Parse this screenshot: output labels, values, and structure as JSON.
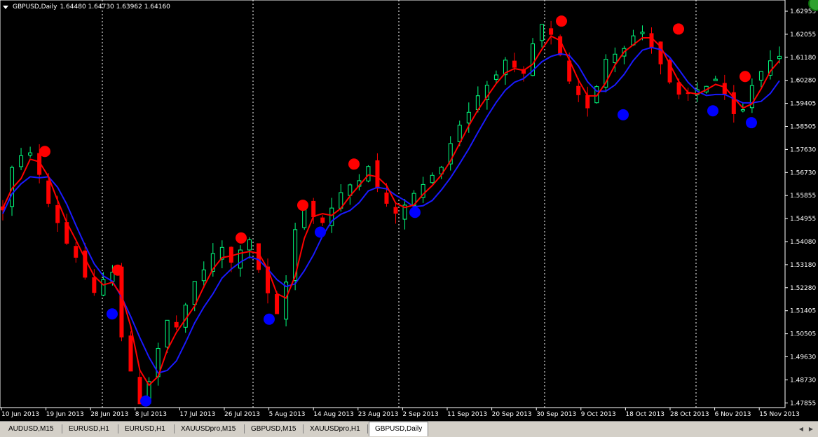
{
  "title": {
    "symbol": "GBPUSD,Daily",
    "ohlc": "1.64480 1.64730 1.63962 1.64160"
  },
  "axis": {
    "price_labels": [
      "1.62955",
      "1.62055",
      "1.61180",
      "1.60280",
      "1.59405",
      "1.58505",
      "1.57630",
      "1.56730",
      "1.55855",
      "1.54955",
      "1.54080",
      "1.53180",
      "1.52280",
      "1.51405",
      "1.50505",
      "1.49630",
      "1.48730",
      "1.47855"
    ],
    "date_labels": [
      "10 Jun 2013",
      "19 Jun 2013",
      "28 Jun 2013",
      "8 Jul 2013",
      "17 Jul 2013",
      "26 Jul 2013",
      "5 Aug 2013",
      "14 Aug 2013",
      "23 Aug 2013",
      "2 Sep 2013",
      "11 Sep 2013",
      "20 Sep 2013",
      "30 Sep 2013",
      "9 Oct 2013",
      "18 Oct 2013",
      "28 Oct 2013",
      "6 Nov 2013",
      "15 Nov 2013"
    ]
  },
  "tabs": [
    {
      "label": "AUDUSD,M15",
      "active": false
    },
    {
      "label": "EURUSD,H1",
      "active": false
    },
    {
      "label": "EURUSD,H1",
      "active": false
    },
    {
      "label": "XAUUSDpro,M15",
      "active": false
    },
    {
      "label": "GBPUSD,M15",
      "active": false
    },
    {
      "label": "XAUUSDpro,H1",
      "active": false
    },
    {
      "label": "GBPUSD,Daily",
      "active": true
    }
  ],
  "colors": {
    "background": "#000000",
    "bull": "#00ff7f",
    "bear": "#ff0000",
    "red_line": "#ff0000",
    "blue_line": "#1a1aff",
    "grid": "#ffffff",
    "axis_text": "#ffffff"
  },
  "chart_data": {
    "type": "candlestick",
    "x_start": "10 Jun 2013",
    "x_end": "19 Nov 2013",
    "ylim": [
      1.4775,
      1.632
    ],
    "trend_close_approx": [
      1.553,
      1.568,
      1.572,
      1.575,
      1.565,
      1.555,
      1.548,
      1.54,
      1.535,
      1.527,
      1.52,
      1.525,
      1.53,
      1.505,
      1.49,
      1.48,
      1.488,
      1.5,
      1.51,
      1.508,
      1.515,
      1.525,
      1.53,
      1.535,
      1.538,
      1.532,
      1.538,
      1.54,
      1.53,
      1.52,
      1.512,
      1.525,
      1.545,
      1.555,
      1.55,
      1.548,
      1.553,
      1.558,
      1.562,
      1.565,
      1.57,
      1.56,
      1.555,
      1.55,
      1.555,
      1.558,
      1.562,
      1.565,
      1.57,
      1.578,
      1.585,
      1.59,
      1.596,
      1.6,
      1.605,
      1.608,
      1.605,
      1.603,
      1.615,
      1.622,
      1.618,
      1.61,
      1.6,
      1.595,
      1.592,
      1.6,
      1.61,
      1.612,
      1.615,
      1.618,
      1.62,
      1.615,
      1.608,
      1.6,
      1.595,
      1.596,
      1.598,
      1.6,
      1.602,
      1.595,
      1.588,
      1.59,
      1.6,
      1.605,
      1.61,
      1.612
    ],
    "markers_red": [
      {
        "date": "19 Jun 2013",
        "price": 1.5746
      },
      {
        "date": "1 Jul 2013",
        "price": 1.5296
      },
      {
        "date": "26 Jul 2013",
        "price": 1.5418
      },
      {
        "date": "6 Aug 2013",
        "price": 1.5542
      },
      {
        "date": "19 Aug 2013",
        "price": 1.5698
      },
      {
        "date": "30 Sep 2013",
        "price": 1.624
      },
      {
        "date": "25 Oct 2013",
        "price": 1.621
      },
      {
        "date": "8 Nov 2013",
        "price": 1.603
      }
    ],
    "markers_blue": [
      {
        "date": "28 Jun 2013",
        "price": 1.513
      },
      {
        "date": "8 Jul 2013",
        "price": 1.48
      },
      {
        "date": "2 Aug 2013",
        "price": 1.511
      },
      {
        "date": "15 Aug 2013",
        "price": 1.544
      },
      {
        "date": "30 Aug 2013",
        "price": 1.5515
      },
      {
        "date": "10 Oct 2013",
        "price": 1.5885
      },
      {
        "date": "5 Nov 2013",
        "price": 1.59
      },
      {
        "date": "12 Nov 2013",
        "price": 1.5855
      }
    ],
    "vertical_dotted_lines": [
      "28 Jun 2013",
      "1 Aug 2013",
      "2 Sep 2013",
      "30 Sep 2013",
      "1 Nov 2013"
    ]
  }
}
